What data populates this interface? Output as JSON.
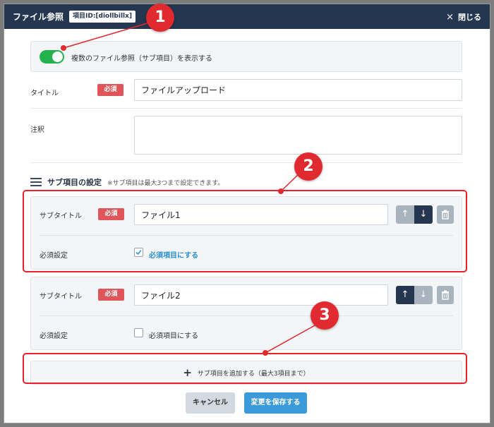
{
  "header": {
    "title": "ファイル参照",
    "id_badge": "項目ID:[diollbillx]",
    "close_label": "閉じる",
    "close_icon": "×"
  },
  "toggle": {
    "label": "複数のファイル参照（サブ項目）を表示する",
    "on": true
  },
  "title_field": {
    "label": "タイトル",
    "required_badge": "必須",
    "value": "ファイルアップロード"
  },
  "note_field": {
    "label": "注釈",
    "value": ""
  },
  "sub_section": {
    "title": "サブ項目の設定",
    "note": "※サブ項目は最大3つまで設定できます。"
  },
  "sub_items": [
    {
      "subtitle_label": "サブタイトル",
      "required_badge": "必須",
      "value": "ファイル1",
      "required_setting_label": "必須設定",
      "checkbox_label": "必須項目にする",
      "checked": true,
      "up_arrow": "↑",
      "down_arrow": "↓"
    },
    {
      "subtitle_label": "サブタイトル",
      "required_badge": "必須",
      "value": "ファイル2",
      "required_setting_label": "必須設定",
      "checkbox_label": "必須項目にする",
      "checked": false,
      "up_arrow": "↑",
      "down_arrow": "↓"
    }
  ],
  "add_button": {
    "icon": "+",
    "label": "サブ項目を追加する（最大3項目まで）"
  },
  "footer": {
    "cancel_label": "キャンセル",
    "save_label": "変更を保存する"
  },
  "callouts": [
    "1",
    "2",
    "3"
  ],
  "colors": {
    "header": "#253650",
    "accent": "#3b9ad9",
    "required": "#e0555a",
    "toggle_on": "#22b14c",
    "callout": "#e02a30"
  }
}
